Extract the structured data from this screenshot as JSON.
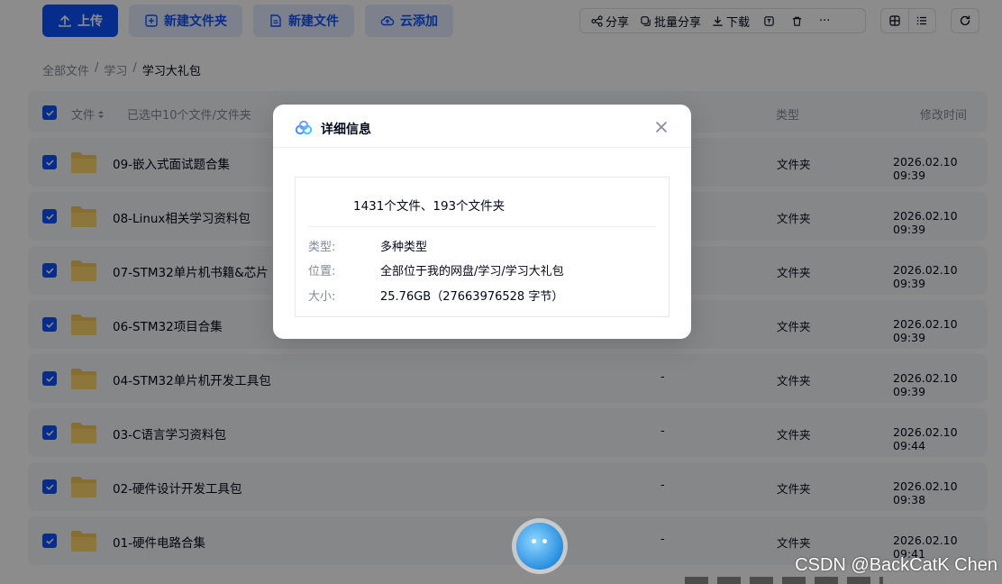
{
  "toolbar": {
    "upload": "上传",
    "new_folder": "新建文件夹",
    "new_file": "新建文件",
    "cloud_add": "云添加",
    "share": "分享",
    "batch_share": "批量分享",
    "download": "下载",
    "more": "···"
  },
  "breadcrumb": {
    "root": "全部文件",
    "level1": "学习",
    "current": "学习大礼包",
    "sep": "/"
  },
  "table": {
    "col_file": "文件",
    "selection_info": "已选中10个文件/文件夹",
    "col_type": "类型",
    "col_time": "修改时间",
    "rows": [
      {
        "name": "09-嵌入式面试题合集",
        "size": "",
        "type": "文件夹",
        "time": "2026.02.10 09:39"
      },
      {
        "name": "08-Linux相关学习资料包",
        "size": "",
        "type": "文件夹",
        "time": "2026.02.10 09:39"
      },
      {
        "name": "07-STM32单片机书籍&芯片",
        "size": "",
        "type": "文件夹",
        "time": "2026.02.10 09:39"
      },
      {
        "name": "06-STM32项目合集",
        "size": "",
        "type": "文件夹",
        "time": "2026.02.10 09:39"
      },
      {
        "name": "04-STM32单片机开发工具包",
        "size": "-",
        "type": "文件夹",
        "time": "2026.02.10 09:39"
      },
      {
        "name": "03-C语言学习资料包",
        "size": "-",
        "type": "文件夹",
        "time": "2026.02.10 09:44"
      },
      {
        "name": "02-硬件设计开发工具包",
        "size": "-",
        "type": "文件夹",
        "time": "2026.02.10 09:38"
      },
      {
        "name": "01-硬件电路合集",
        "size": "-",
        "type": "文件夹",
        "time": "2026.02.10 09:41"
      }
    ]
  },
  "dialog": {
    "title": "详细信息",
    "summary": "1431个文件、193个文件夹",
    "type_label": "类型:",
    "type_value": "多种类型",
    "location_label": "位置:",
    "location_value": "全部位于我的网盘/学习/学习大礼包",
    "size_label": "大小:",
    "size_value": "25.76GB（27663976528 字节）"
  },
  "watermark": "CSDN @BackCatK Chen",
  "colors": {
    "accent": "#0d53ff",
    "soft_accent": "#e3ebff",
    "row_bg": "#f5f6fa",
    "folder": "#f5c85c"
  },
  "icons": [
    "upload-icon",
    "new-folder-icon",
    "new-file-icon",
    "cloud-add-icon",
    "share-icon",
    "batch-share-icon",
    "download-icon",
    "rename-icon",
    "delete-icon",
    "grid-view-icon",
    "list-view-icon",
    "refresh-icon",
    "folder-icon",
    "check-icon",
    "close-icon",
    "app-logo-icon"
  ]
}
